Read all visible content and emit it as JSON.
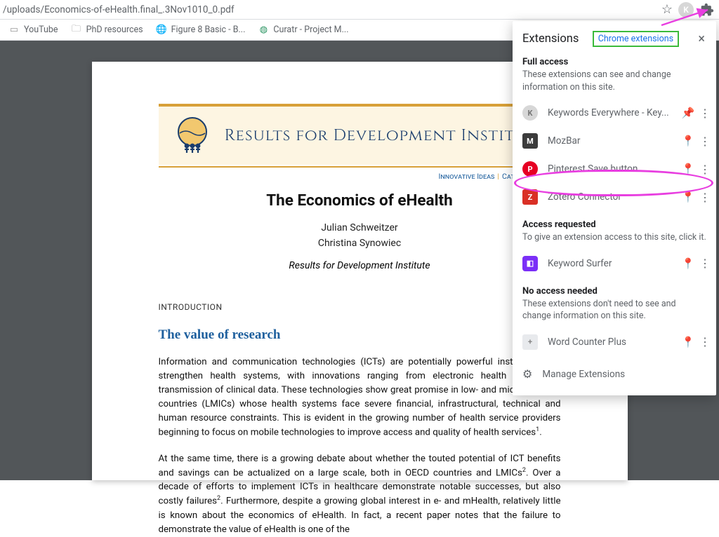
{
  "address_bar": {
    "url": "/uploads/Economics-of-eHealth.final_.3Nov1010_0.pdf"
  },
  "bookmarks": [
    {
      "label": "YouTube",
      "iconType": "text"
    },
    {
      "label": "PhD resources",
      "iconType": "folder"
    },
    {
      "label": "Figure 8 Basic - B...",
      "iconType": "globe"
    },
    {
      "label": "Curatr - Project M...",
      "iconType": "curatr"
    }
  ],
  "document": {
    "banner_title": "Results for Development Institute",
    "subtitle_a": "Innovative Ideas",
    "subtitle_b": "Catalytic Action",
    "title": "The Economics of eHealth",
    "authors": [
      "Julian Schweitzer",
      "Christina Synowiec"
    ],
    "affiliation": "Results for Development Institute",
    "intro_label": "INTRODUCTION",
    "heading": "The value of research",
    "para1": "Information and communication technologies (ICTs) are potentially powerful instruments to strengthen health systems, with innovations ranging from electronic health records to transmission of clinical data. These technologies show great promise in low- and middle-income countries (LMICs) whose health systems face severe financial, infrastructural, technical and human resource constraints. This is evident in the growing number of health service providers beginning to focus on mobile technologies to improve access and quality of health services",
    "para2a": "At the same time, there is a growing debate about whether the touted potential of ICT benefits and savings can be actualized on a large scale, both in OECD countries and LMICs",
    "para2b": ". Over a decade of efforts to implement ICTs in healthcare demonstrate notable successes, but also costly failures",
    "para2c": ". Furthermore, despite a growing global interest in e- and mHealth, relatively little is known about the economics of eHealth. In fact, a recent paper notes that the failure to demonstrate the value of eHealth is one of the"
  },
  "extensions_panel": {
    "title": "Extensions",
    "chrome_link": "Chrome extensions",
    "sections": {
      "full": {
        "label": "Full access",
        "desc": "These extensions can see and change information on this site."
      },
      "requested": {
        "label": "Access requested",
        "desc": "To give an extension access to this site, click it."
      },
      "none": {
        "label": "No access needed",
        "desc": "These extensions don't need to see and change information on this site."
      }
    },
    "full_items": [
      {
        "name": "Keywords Everywhere - Key...",
        "bg": "#d7d7d7",
        "txt": "K",
        "pinned": true
      },
      {
        "name": "MozBar",
        "bg": "#3b3b3b",
        "txt": "M",
        "pinned": false
      },
      {
        "name": "Pinterest Save button",
        "bg": "#e60023",
        "txt": "P",
        "pinned": false
      },
      {
        "name": "Zotero Connector",
        "bg": "#d93025",
        "txt": "Z",
        "pinned": false
      }
    ],
    "requested_items": [
      {
        "name": "Keyword Surfer",
        "bg": "#7b2ff7",
        "txt": "◧",
        "pinned": false
      }
    ],
    "none_items": [
      {
        "name": "Word Counter Plus",
        "bg": "#e8eaed",
        "txt": "+",
        "pinned": false
      }
    ],
    "manage_label": "Manage Extensions"
  }
}
